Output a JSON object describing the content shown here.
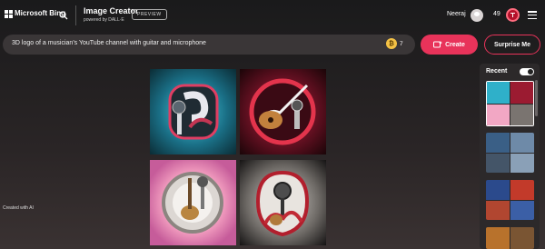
{
  "header": {
    "brand": "Microsoft Bing",
    "product_title": "Image Creator",
    "product_subtitle": "powered by DALL·E",
    "badge": "PREVIEW",
    "user_name": "Neeraj",
    "boost_count": "49"
  },
  "prompt": {
    "value": "3D logo of a musician's YouTube channel with guitar and microphone",
    "boosts": "7"
  },
  "actions": {
    "create_label": "Create",
    "surprise_label": "Surprise Me"
  },
  "watermark": "Created with AI",
  "recent": {
    "title": "Recent"
  },
  "colors": {
    "accent": "#e8335a",
    "background": "#1c1a1b",
    "prompt_bg": "#3a3637"
  },
  "icons": [
    "microsoft-logo-icon",
    "search-icon",
    "user-avatar-icon",
    "reward-icon",
    "menu-icon",
    "boost-coin-icon",
    "create-sparkle-icon"
  ]
}
